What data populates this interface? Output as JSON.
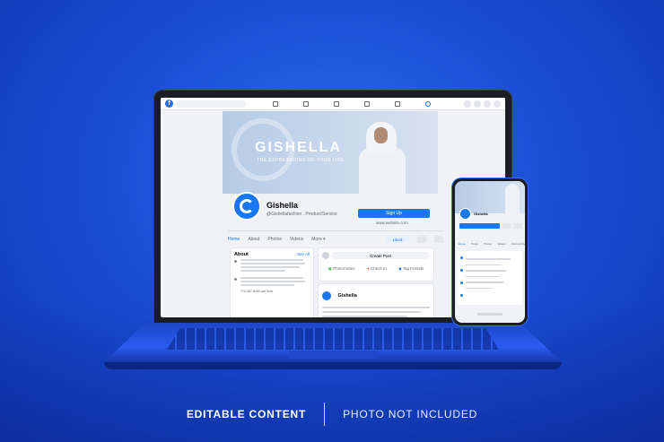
{
  "colors": {
    "background": "#1a4fd8",
    "fb_blue": "#1877f2",
    "screen_bg": "#f0f2f5"
  },
  "fb": {
    "logo": "f",
    "nav_icons": [
      "home-icon",
      "watch-icon",
      "marketplace-icon",
      "groups-icon",
      "gaming-icon",
      "pages-icon"
    ]
  },
  "cover": {
    "title": "GISHELLA",
    "subtitle": "THE EXPRESSIONS OF YOUR LIFE"
  },
  "profile": {
    "name": "Gishella",
    "handle": "@Gishellafashion . Product/Service",
    "signup_label": "Sign Up",
    "website": "www.website.com"
  },
  "tabs": {
    "items": [
      "Home",
      "About",
      "Photos",
      "Videos",
      "More ▾"
    ],
    "liked_label": "Liked"
  },
  "about": {
    "title": "About",
    "see_all": "See All",
    "phone": "770-367-8490 call Now"
  },
  "create_post": {
    "button": "Create Post",
    "photo_video": "Photo/Video",
    "check_in": "Check In",
    "tag_friends": "Tag Friends"
  },
  "post": {
    "name": "Gishella"
  },
  "phone": {
    "name": "Gishella",
    "tabs": [
      "Home",
      "Posts",
      "Photos",
      "Videos",
      "Community"
    ]
  },
  "footer": {
    "left": "EDITABLE CONTENT",
    "right": "PHOTO NOT INCLUDED"
  }
}
